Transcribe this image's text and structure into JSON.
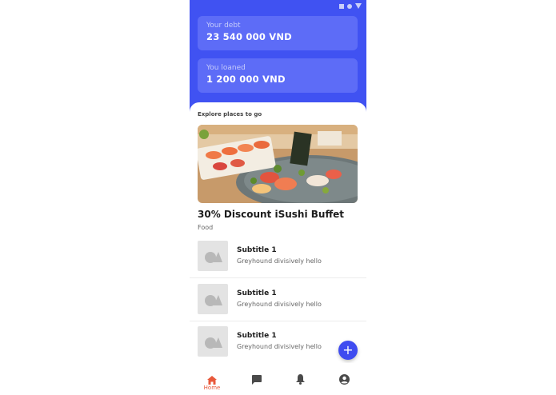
{
  "summary": {
    "debt_label": "Your debt",
    "debt_value": "23 540 000 VND",
    "loan_label": "You loaned",
    "loan_value": "1 200 000 VND"
  },
  "explore": {
    "heading": "Explore places to go",
    "promo_title": "30% Discount iSushi Buffet",
    "promo_category": "Food"
  },
  "list": [
    {
      "title": "Subtitle 1",
      "subtitle": "Greyhound divisively hello"
    },
    {
      "title": "Subtitle 1",
      "subtitle": "Greyhound divisively hello"
    },
    {
      "title": "Subtitle 1",
      "subtitle": "Greyhound divisively hello"
    }
  ],
  "fab": {
    "label": "+"
  },
  "nav": {
    "home_label": "Home",
    "active": "home",
    "items": [
      "home-icon",
      "chat-icon",
      "bell-icon",
      "account-icon"
    ]
  },
  "colors": {
    "header": "#4052f2",
    "card": "#5d6cf7",
    "accent": "#e8593b",
    "fab": "#3f4cf0"
  }
}
